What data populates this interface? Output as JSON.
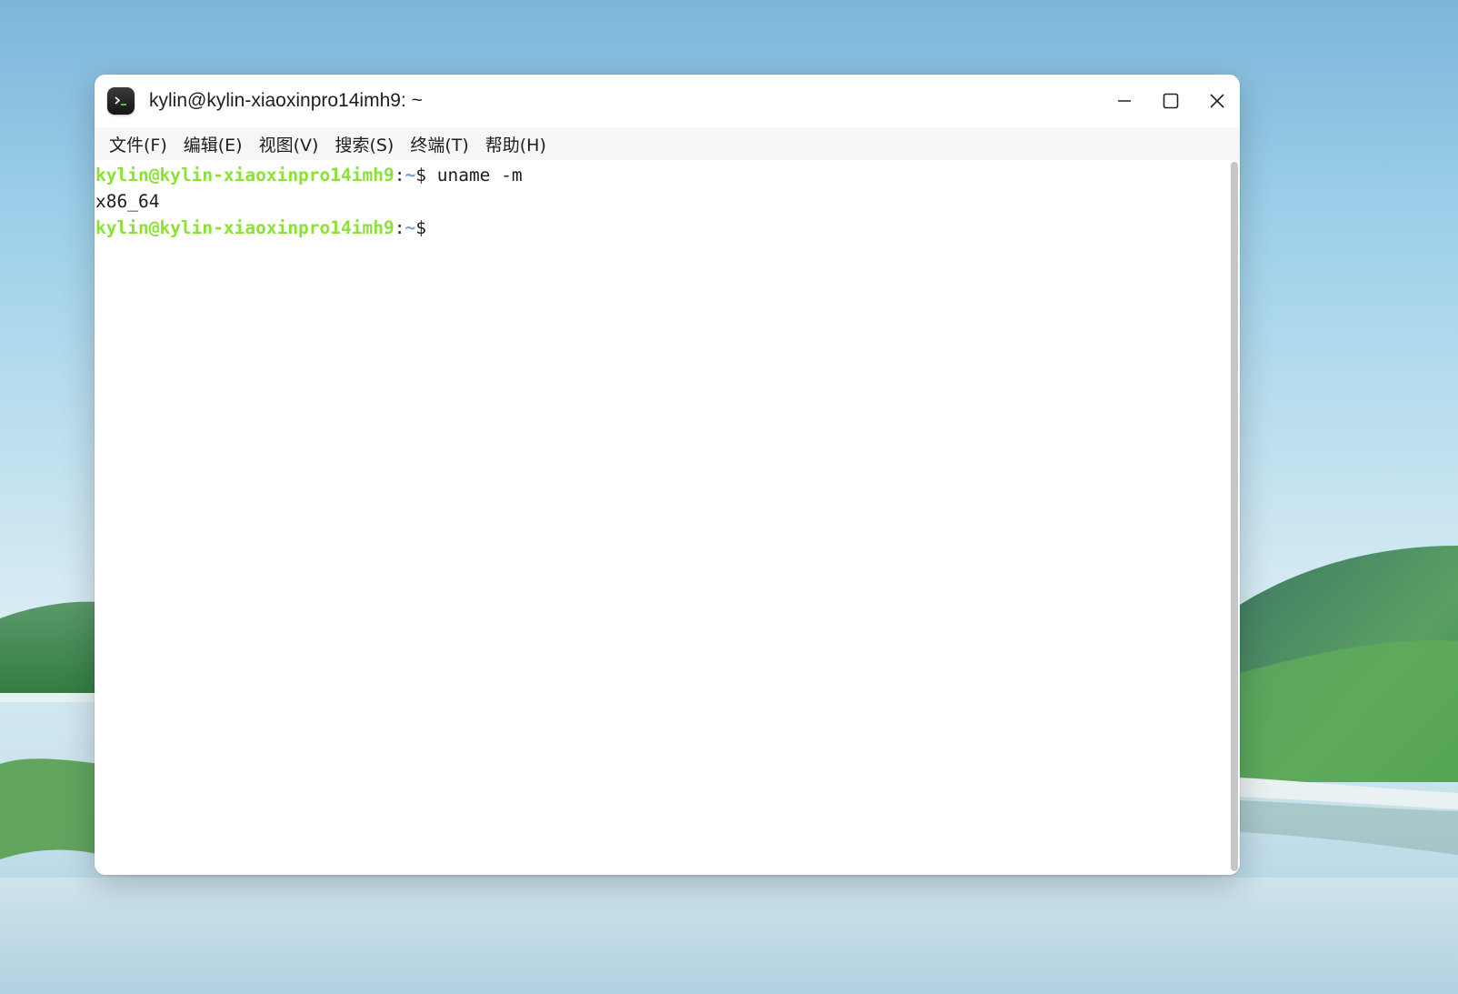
{
  "window": {
    "title": "kylin@kylin-xiaoxinpro14imh9: ~"
  },
  "menu": [
    {
      "label": "文件(F)"
    },
    {
      "label": "编辑(E)"
    },
    {
      "label": "视图(V)"
    },
    {
      "label": "搜索(S)"
    },
    {
      "label": "终端(T)"
    },
    {
      "label": "帮助(H)"
    }
  ],
  "terminal": {
    "prompt": {
      "user_host": "kylin@kylin-xiaoxinpro14imh9",
      "colon": ":",
      "path": "~",
      "dollar": "$"
    },
    "line1_command": " uname -m",
    "line2_output": "x86_64",
    "line3_command": ""
  },
  "colors": {
    "prompt_user": "#8ae234",
    "prompt_path": "#729fcf",
    "text": "#1e1e1e"
  },
  "icons": {
    "app": "terminal-icon",
    "minimize": "minimize-icon",
    "maximize": "maximize-icon",
    "close": "close-icon"
  }
}
